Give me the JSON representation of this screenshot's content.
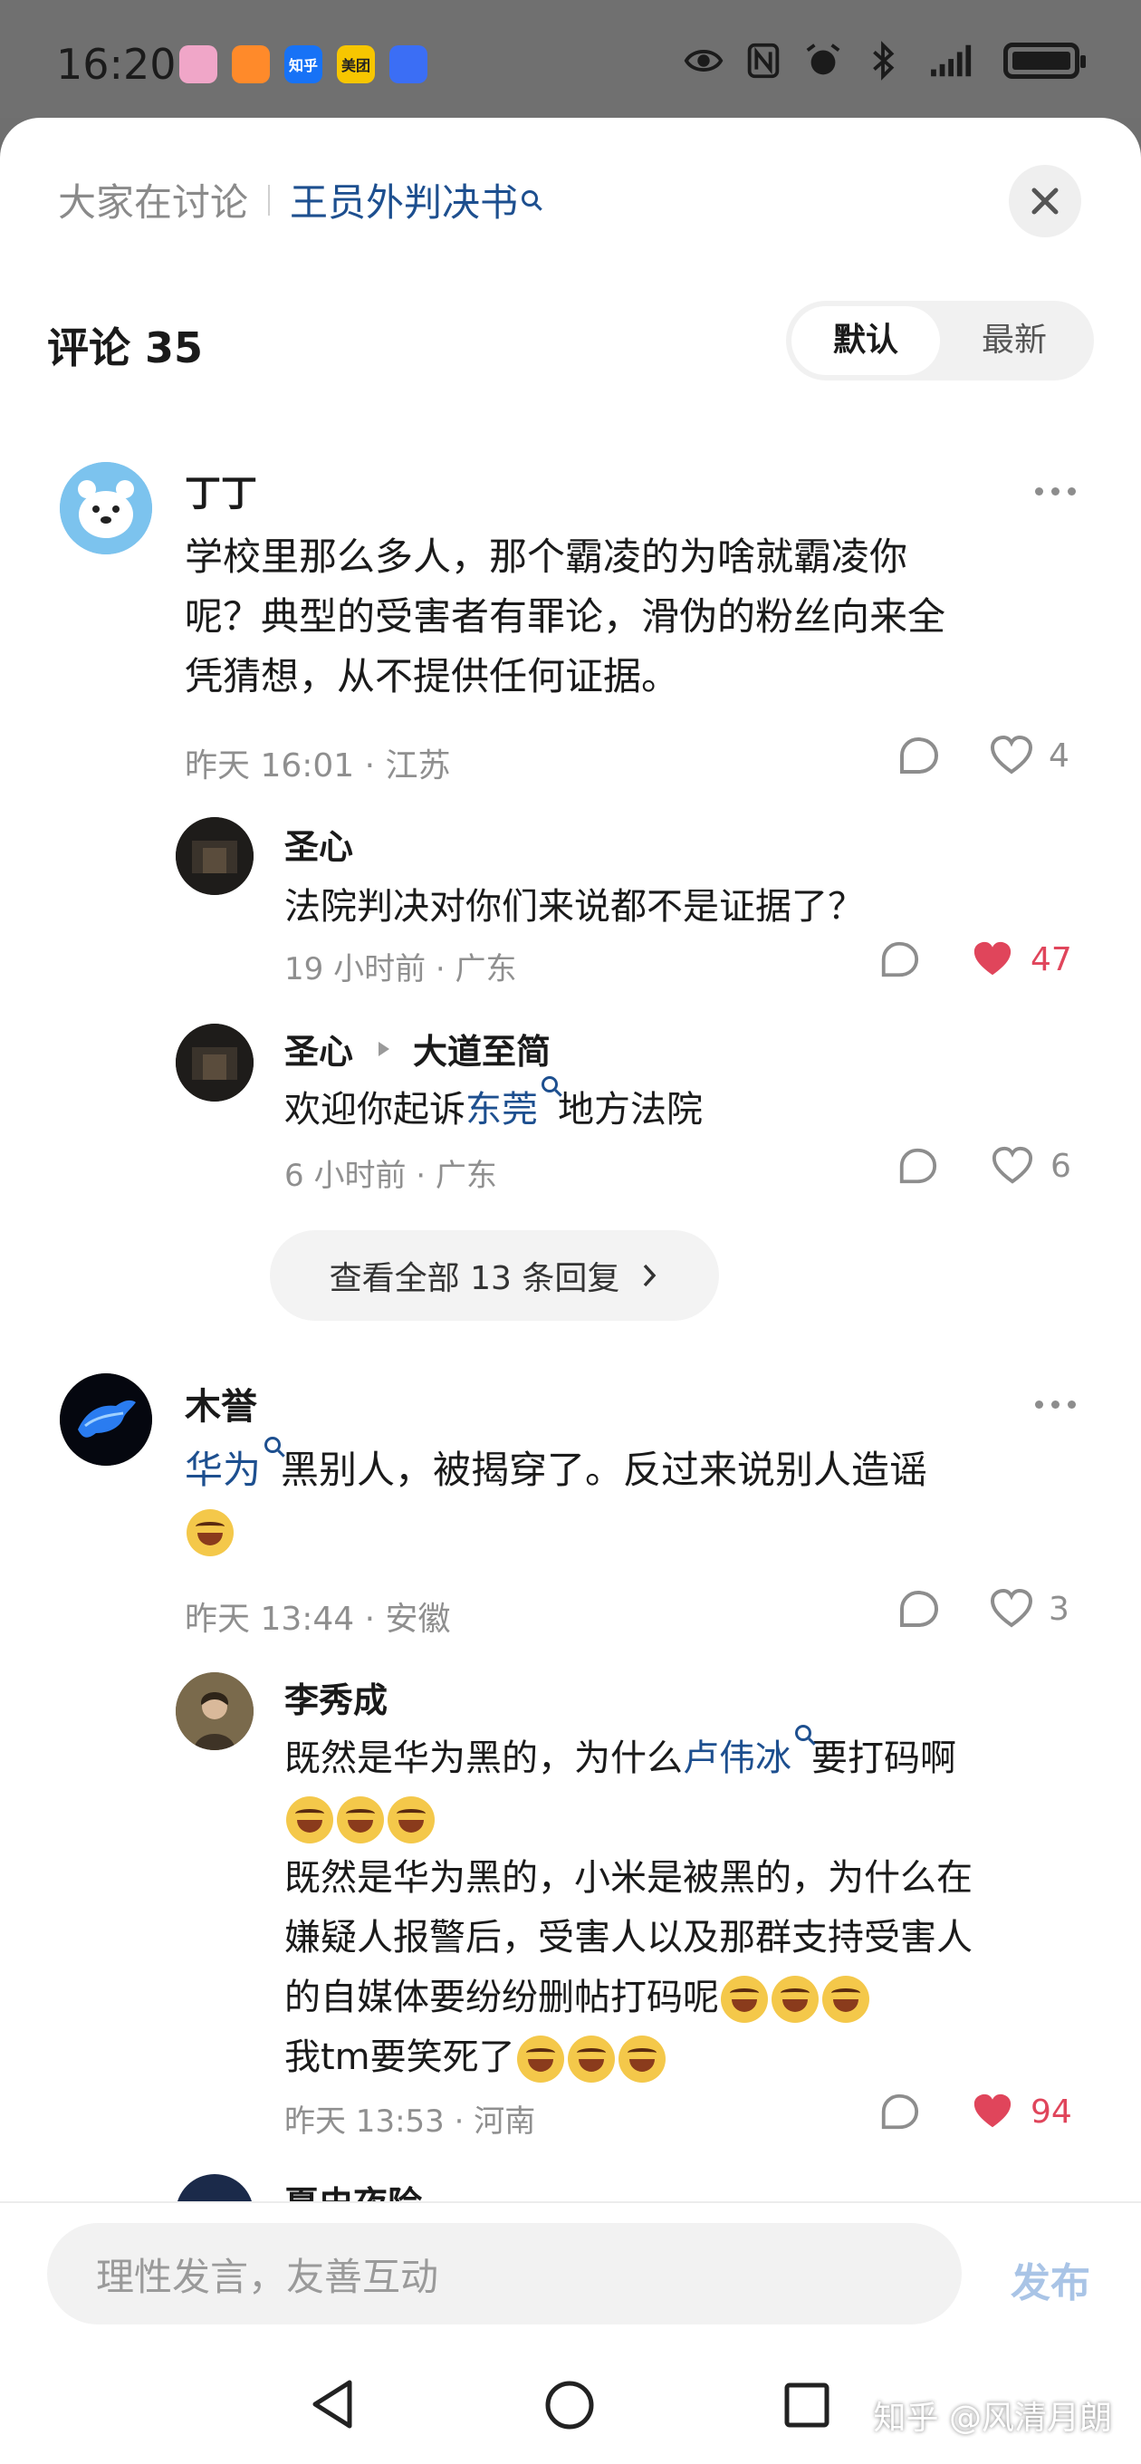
{
  "status_bar": {
    "time": "16:20",
    "apps": [
      {
        "name": "app-1",
        "label": "",
        "color": "#f0a6c8"
      },
      {
        "name": "app-2",
        "label": "",
        "color": "#ff8a2a"
      },
      {
        "name": "zhihu",
        "label": "知乎",
        "color": "#1772f6"
      },
      {
        "name": "meituan",
        "label": "美团",
        "color": "#f7c600"
      },
      {
        "name": "app-5",
        "label": "",
        "color": "#3b6ef5"
      }
    ]
  },
  "sheet": {
    "discuss_label": "大家在讨论",
    "topic": "王员外判决书",
    "comments_title": "评论 35",
    "sort_options": [
      "默认",
      "最新"
    ],
    "active_sort": "默认"
  },
  "comments": [
    {
      "user": "丁丁",
      "text": "学校里那么多人，那个霸凌的为啥就霸凌你呢？典型的受害者有罪论，滑伪的粉丝向来全凭猜想，从不提供任何证据。",
      "text_lines": [
        "学校里那么多人，那个霸凌的为啥就霸凌你",
        "呢？典型的受害者有罪论，滑伪的粉丝向来全",
        "凭猜想，从不提供任何证据。"
      ],
      "time": "昨天 16:01",
      "location": "江苏",
      "likes": "4",
      "liked": false,
      "replies": [
        {
          "user": "圣心",
          "reply_to": "",
          "text": "法院判决对你们来说都不是证据了？",
          "time": "19 小时前",
          "location": "广东",
          "likes": "47",
          "liked": true
        },
        {
          "user": "圣心",
          "reply_to": "大道至简",
          "text_before": "欢迎你起诉",
          "link": "东莞",
          "text_after": "地方法院",
          "time": "6 小时前",
          "location": "广东",
          "likes": "6",
          "liked": false
        }
      ],
      "view_all": "查看全部 13 条回复"
    },
    {
      "user": "木誉",
      "link": "华为",
      "text_after": "黑别人，被揭穿了。反过来说别人造谣",
      "time": "昨天 13:44",
      "location": "安徽",
      "likes": "3",
      "liked": false,
      "replies": [
        {
          "user": "李秀成",
          "line1_before": "既然是华为黑的，为什么",
          "line1_link": "卢伟冰",
          "line1_after": "要打码啊",
          "line3": "既然是华为黑的，小米是被黑的，为什么在",
          "line4": "嫌疑人报警后，受害人以及那群支持受害人",
          "line5": "的自媒体要纷纷删帖打码呢",
          "line6": "我tm要笑死了",
          "time": "昨天 13:53",
          "location": "河南",
          "likes": "94",
          "liked": true
        }
      ]
    },
    {
      "user": "夏史夜险"
    }
  ],
  "composer": {
    "placeholder": "理性发言，友善互动",
    "publish": "发布"
  },
  "watermark": "知乎 @风清月朗",
  "colors": {
    "link": "#1d4f8f",
    "liked": "#e0455b",
    "meta": "#8f8f8f"
  }
}
